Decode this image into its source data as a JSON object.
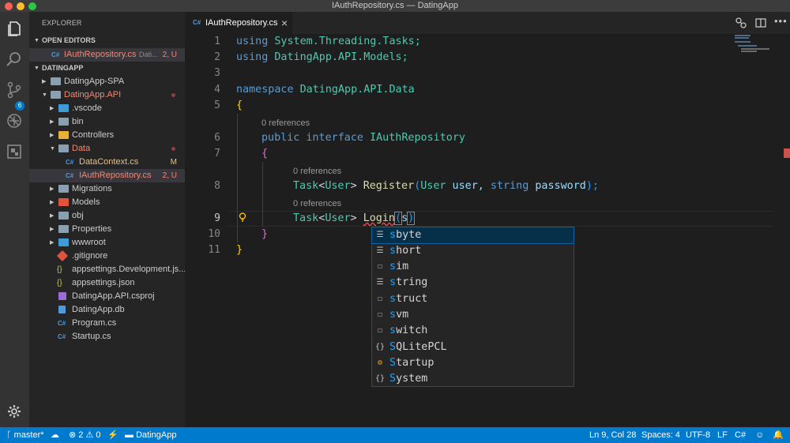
{
  "window": {
    "title": "IAuthRepository.cs — DatingApp"
  },
  "activity": {
    "scm_badge": "6"
  },
  "sidebar": {
    "title": "EXPLORER",
    "open_editors_label": "OPEN EDITORS",
    "open_editor": {
      "lang": "C#",
      "name": "IAuthRepository.cs",
      "dir": "Dati...",
      "badge": "2, U"
    },
    "project_label": "DATINGAPP",
    "tree": [
      {
        "name": "DatingApp-SPA",
        "badge": ""
      },
      {
        "name": "DatingApp.API",
        "badge": ""
      },
      {
        "name": ".vscode",
        "badge": ""
      },
      {
        "name": "bin",
        "badge": ""
      },
      {
        "name": "Controllers",
        "badge": ""
      },
      {
        "name": "Data",
        "badge": ""
      },
      {
        "name": "DataContext.cs",
        "badge": "M",
        "lang": "C#"
      },
      {
        "name": "IAuthRepository.cs",
        "badge": "2, U",
        "lang": "C#"
      },
      {
        "name": "Migrations",
        "badge": ""
      },
      {
        "name": "Models",
        "badge": ""
      },
      {
        "name": "obj",
        "badge": ""
      },
      {
        "name": "Properties",
        "badge": ""
      },
      {
        "name": "wwwroot",
        "badge": ""
      },
      {
        "name": ".gitignore",
        "badge": ""
      },
      {
        "name": "appsettings.Development.js...",
        "badge": ""
      },
      {
        "name": "appsettings.json",
        "badge": ""
      },
      {
        "name": "DatingApp.API.csproj",
        "badge": ""
      },
      {
        "name": "DatingApp.db",
        "badge": ""
      },
      {
        "name": "Program.cs",
        "badge": "",
        "lang": "C#"
      },
      {
        "name": "Startup.cs",
        "badge": "",
        "lang": "C#"
      }
    ]
  },
  "tabs": [
    {
      "lang": "C#",
      "label": "IAuthRepository.cs",
      "close": "×"
    }
  ],
  "editor": {
    "line_numbers": [
      "1",
      "2",
      "3",
      "4",
      "5",
      "6",
      "7",
      "8",
      "9",
      "10",
      "11"
    ],
    "codelens": "0 references",
    "code": {
      "l1": {
        "a": "using",
        "b": " System.Threading.Tasks;"
      },
      "l2": {
        "a": "using",
        "b": " DatingApp.API.Models;"
      },
      "l4": {
        "a": "namespace",
        "b": " DatingApp.API.Data"
      },
      "l5": "{",
      "l6": {
        "a": "public",
        "b": " interface ",
        "c": "IAuthRepository"
      },
      "l7": "{",
      "l8": {
        "a": "Task",
        "b": "<",
        "c": "User",
        "d": "> ",
        "e": "Register",
        "f": "(",
        "g": "User",
        "h": " user, ",
        "i": "string",
        "j": " password",
        "k": ");"
      },
      "l9": {
        "a": "Task",
        "b": "<",
        "c": "User",
        "d": "> ",
        "e": "Login",
        "f": "(",
        "g": "s",
        "h": ")"
      },
      "l10": "}",
      "l11": "}"
    }
  },
  "suggestions": [
    {
      "icon": "keyword",
      "match": "s",
      "rest": "byte"
    },
    {
      "icon": "keyword",
      "match": "s",
      "rest": "hort"
    },
    {
      "icon": "snippet",
      "match": "s",
      "rest": "im"
    },
    {
      "icon": "keyword",
      "match": "s",
      "rest": "tring"
    },
    {
      "icon": "snippet",
      "match": "s",
      "rest": "truct"
    },
    {
      "icon": "snippet",
      "match": "s",
      "rest": "vm"
    },
    {
      "icon": "snippet",
      "match": "s",
      "rest": "witch"
    },
    {
      "icon": "namespace",
      "match": "S",
      "rest": "QLitePCL"
    },
    {
      "icon": "class",
      "match": "S",
      "rest": "tartup"
    },
    {
      "icon": "namespace",
      "match": "S",
      "rest": "ystem"
    }
  ],
  "status": {
    "branch": "master*",
    "errors": "2",
    "warnings": "0",
    "folder": "DatingApp",
    "position": "Ln 9, Col 28",
    "spaces": "Spaces: 4",
    "encoding": "UTF-8",
    "eol": "LF",
    "language": "C#"
  },
  "colors": {
    "accent": "#007acc",
    "error": "#f48771",
    "modified": "#e2c08d"
  }
}
